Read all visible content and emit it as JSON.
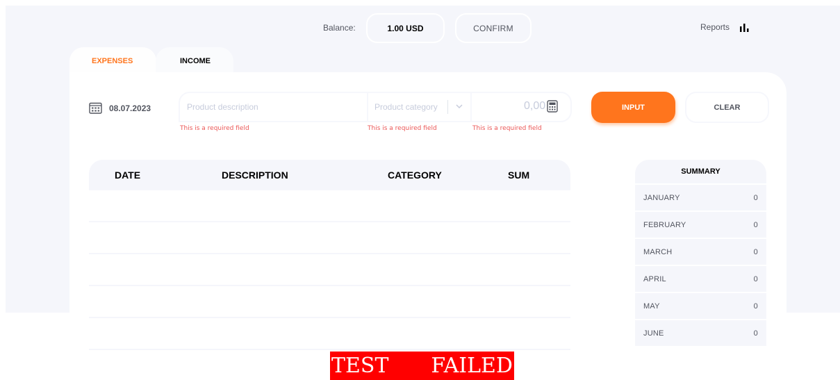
{
  "header": {
    "balance_label": "Balance:",
    "balance_value": "1.00 USD",
    "confirm_label": "CONFIRM",
    "reports_label": "Reports",
    "reports_icon": "bar-chart-icon"
  },
  "tabs": [
    {
      "label": "EXPENSES",
      "active": true
    },
    {
      "label": "INCOME",
      "active": false
    }
  ],
  "form": {
    "date": "08.07.2023",
    "date_icon": "calendar-icon",
    "description_placeholder": "Product description",
    "category_placeholder": "Product category",
    "sum_placeholder": "0,00",
    "sum_icon": "calculator-icon",
    "errors": {
      "description": "This is a required field",
      "category": "This is a required field",
      "sum": "This is a required field"
    },
    "input_button": "INPUT",
    "clear_button": "CLEAR"
  },
  "table": {
    "headers": [
      "DATE",
      "DESCRIPTION",
      "CATEGORY",
      "SUM"
    ],
    "rows": []
  },
  "summary": {
    "title": "SUMMARY",
    "months": [
      {
        "name": "JANUARY",
        "value": "0"
      },
      {
        "name": "FEBRUARY",
        "value": "0"
      },
      {
        "name": "MARCH",
        "value": "0"
      },
      {
        "name": "APRIL",
        "value": "0"
      },
      {
        "name": "MAY",
        "value": "0"
      },
      {
        "name": "JUNE",
        "value": "0"
      }
    ]
  },
  "banner": {
    "word1": "TEST",
    "word2": "FAILED"
  },
  "colors": {
    "accent": "#ff751d",
    "error": "#eb5757",
    "banner": "#ff0000",
    "panel": "#f5f6fb"
  }
}
